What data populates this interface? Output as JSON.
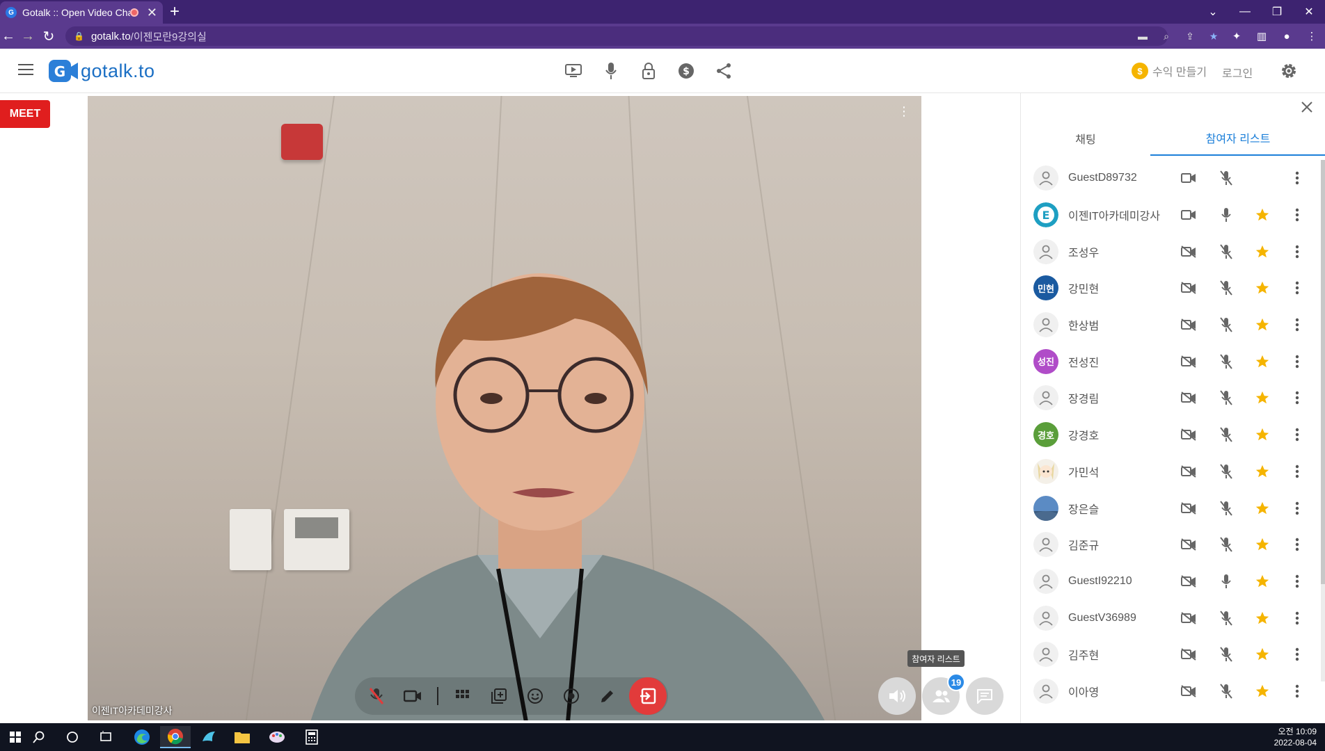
{
  "browser": {
    "tab_title": "Gotalk :: Open Video Chat",
    "tab_close": "✕",
    "new_tab": "+",
    "url_host": "gotalk.to",
    "url_path": "/이젠모란9강의실"
  },
  "app": {
    "logo_text": "gotalk.to",
    "earn_label": "수익 만들기",
    "login_label": "로그인",
    "meet_label": "MEET",
    "video_label": "이젠IT아카데미강사",
    "participant_count": "19",
    "tooltip": "참여자 리스트",
    "accent_color": "#1b7fd9",
    "leave_color": "#e23b3b"
  },
  "sidebar": {
    "tab_chat": "채팅",
    "tab_participants": "참여자 리스트",
    "participants": [
      {
        "name": "GuestD89732",
        "avatar": "default",
        "camera": "on",
        "mic": "off",
        "star": false
      },
      {
        "name": "이젠IT아카데미강사",
        "avatar": "logo",
        "camera": "on",
        "mic": "on",
        "star": true
      },
      {
        "name": "조성우",
        "avatar": "default",
        "camera": "off",
        "mic": "off",
        "star": true
      },
      {
        "name": "강민현",
        "avatar": "initials",
        "initials": "민현",
        "color": "#1a5aa0",
        "camera": "off",
        "mic": "off",
        "star": true
      },
      {
        "name": "한상범",
        "avatar": "default",
        "camera": "off",
        "mic": "off",
        "star": true
      },
      {
        "name": "전성진",
        "avatar": "initials",
        "initials": "성진",
        "color": "#b04cc8",
        "camera": "off",
        "mic": "off",
        "star": true
      },
      {
        "name": "장경림",
        "avatar": "default",
        "camera": "off",
        "mic": "off",
        "star": true
      },
      {
        "name": "강경호",
        "avatar": "initials",
        "initials": "경호",
        "color": "#5a9e3a",
        "camera": "off",
        "mic": "off",
        "star": true
      },
      {
        "name": "가민석",
        "avatar": "anime",
        "camera": "off",
        "mic": "off",
        "star": true
      },
      {
        "name": "장은슬",
        "avatar": "photo",
        "camera": "off",
        "mic": "off",
        "star": true
      },
      {
        "name": "김준규",
        "avatar": "default",
        "camera": "off",
        "mic": "off",
        "star": true
      },
      {
        "name": "GuestI92210",
        "avatar": "default",
        "camera": "off",
        "mic": "on",
        "star": true
      },
      {
        "name": "GuestV36989",
        "avatar": "default",
        "camera": "off",
        "mic": "off",
        "star": true
      },
      {
        "name": "김주현",
        "avatar": "default",
        "camera": "off",
        "mic": "off",
        "star": true
      },
      {
        "name": "이아영",
        "avatar": "default",
        "camera": "off",
        "mic": "off",
        "star": true
      }
    ]
  },
  "taskbar": {
    "time": "오전 10:09",
    "date": "2022-08-04"
  }
}
